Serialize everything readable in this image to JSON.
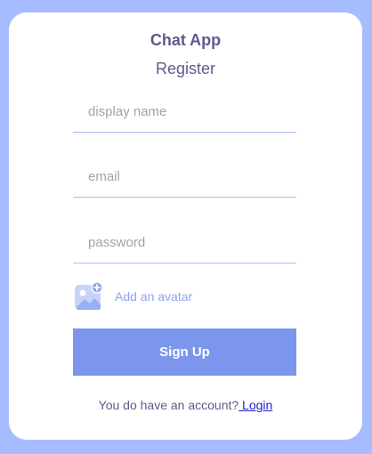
{
  "app": {
    "logo": "Chat App",
    "title": "Register"
  },
  "form": {
    "display_name": {
      "value": "",
      "placeholder": "display name"
    },
    "email": {
      "value": "",
      "placeholder": "email"
    },
    "password": {
      "value": "",
      "placeholder": "password"
    },
    "avatar_label": "Add an avatar",
    "avatar_icon": "add-image-icon",
    "submit_label": "Sign Up"
  },
  "footer": {
    "text": "You do have an account?",
    "link": " Login"
  },
  "colors": {
    "background": "#a7bcff",
    "text": "#5d5b8d",
    "button": "#7b96ec",
    "link": "#1a1adc"
  }
}
